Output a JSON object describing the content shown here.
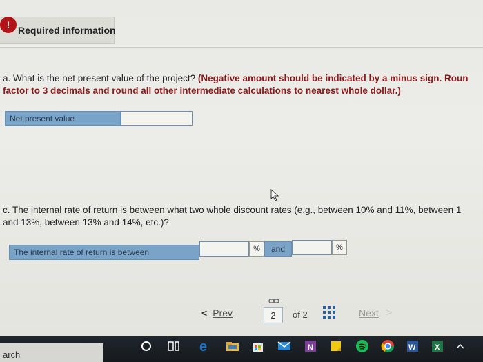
{
  "header": {
    "title": "Required information",
    "icon_glyph": "!"
  },
  "question_a": {
    "text_plain": "a. What is the net present value of the project? ",
    "hint_line1": "(Negative amount should be indicated by a minus sign. Roun",
    "hint_line2": "factor to 3 decimals and round all other intermediate calculations to nearest whole dollar.)",
    "field_label": "Net present value",
    "field_value": ""
  },
  "question_c": {
    "line1": "c. The internal rate of return is between what two whole discount rates (e.g., between 10% and 11%, between 1",
    "line2": "and 13%, between 13% and 14%, etc.)?",
    "field_label": "The internal rate of return is between",
    "rate_low": "",
    "rate_high": "",
    "pct_symbol": "%",
    "and_label": "and"
  },
  "pagination": {
    "prev_arrow": "<",
    "prev_label": "Prev",
    "current_page": "2",
    "of_label": "of 2",
    "next_label": "Next",
    "next_arrow": ">"
  },
  "taskbar": {
    "search_fragment": "arch",
    "colors": {
      "edge": "#1e73c8",
      "word": "#2b5797",
      "excel": "#217346",
      "spotify": "#1db954",
      "onenote": "#7e3f98"
    }
  }
}
